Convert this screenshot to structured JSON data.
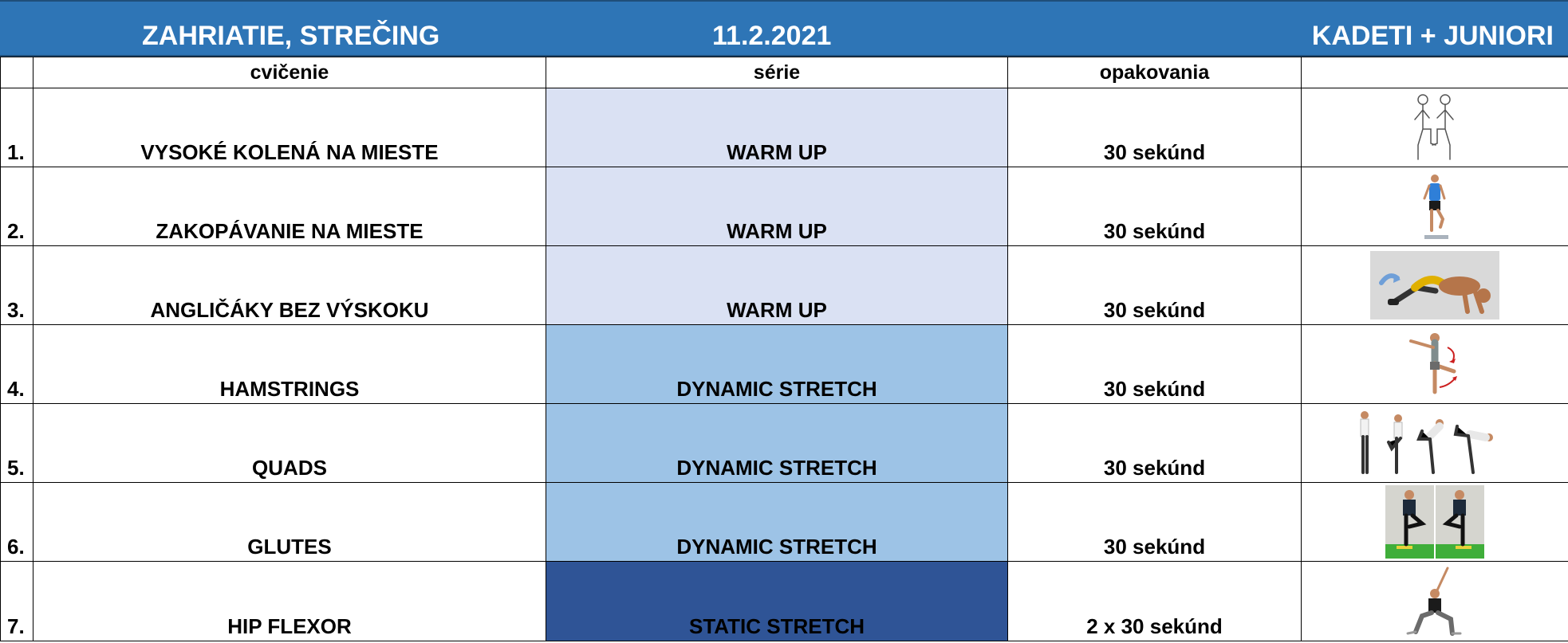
{
  "header": {
    "title": "ZAHRIATIE, STREČING",
    "date": "11.2.2021",
    "group": "KADETI + JUNIORI"
  },
  "columns": {
    "number": "",
    "exercise": "cvičenie",
    "series": "série",
    "reps": "opakovania",
    "image": ""
  },
  "colors": {
    "title_band": "#2e75b6",
    "warm_up": "#dae1f3",
    "dynamic_stretch": "#9dc3e6",
    "static_stretch": "#2f5496"
  },
  "rows": [
    {
      "num": "1.",
      "exercise": "VYSOKÉ KOLENÁ NA MIESTE",
      "series": "WARM UP",
      "reps": "30 sekúnd",
      "image": "high-knees-sketch"
    },
    {
      "num": "2.",
      "exercise": "ZAKOPÁVANIE NA MIESTE",
      "series": "WARM UP",
      "reps": "30 sekúnd",
      "image": "butt-kicks-photo"
    },
    {
      "num": "3.",
      "exercise": "ANGLIČÁKY BEZ VÝSKOKU",
      "series": "WARM UP",
      "reps": "30 sekúnd",
      "image": "burpee-illustration"
    },
    {
      "num": "4.",
      "exercise": "HAMSTRINGS",
      "series": "DYNAMIC STRETCH",
      "reps": "30 sekúnd",
      "image": "leg-swing-illustration"
    },
    {
      "num": "5.",
      "exercise": "QUADS",
      "series": "DYNAMIC STRETCH",
      "reps": "30 sekúnd",
      "image": "quad-stretch-sequence"
    },
    {
      "num": "6.",
      "exercise": "GLUTES",
      "series": "DYNAMIC STRETCH",
      "reps": "30 sekúnd",
      "image": "glute-stretch-photos"
    },
    {
      "num": "7.",
      "exercise": "HIP FLEXOR",
      "series": "STATIC STRETCH",
      "reps": "2 x 30 sekúnd",
      "image": "hip-flexor-lunge-photo"
    }
  ]
}
